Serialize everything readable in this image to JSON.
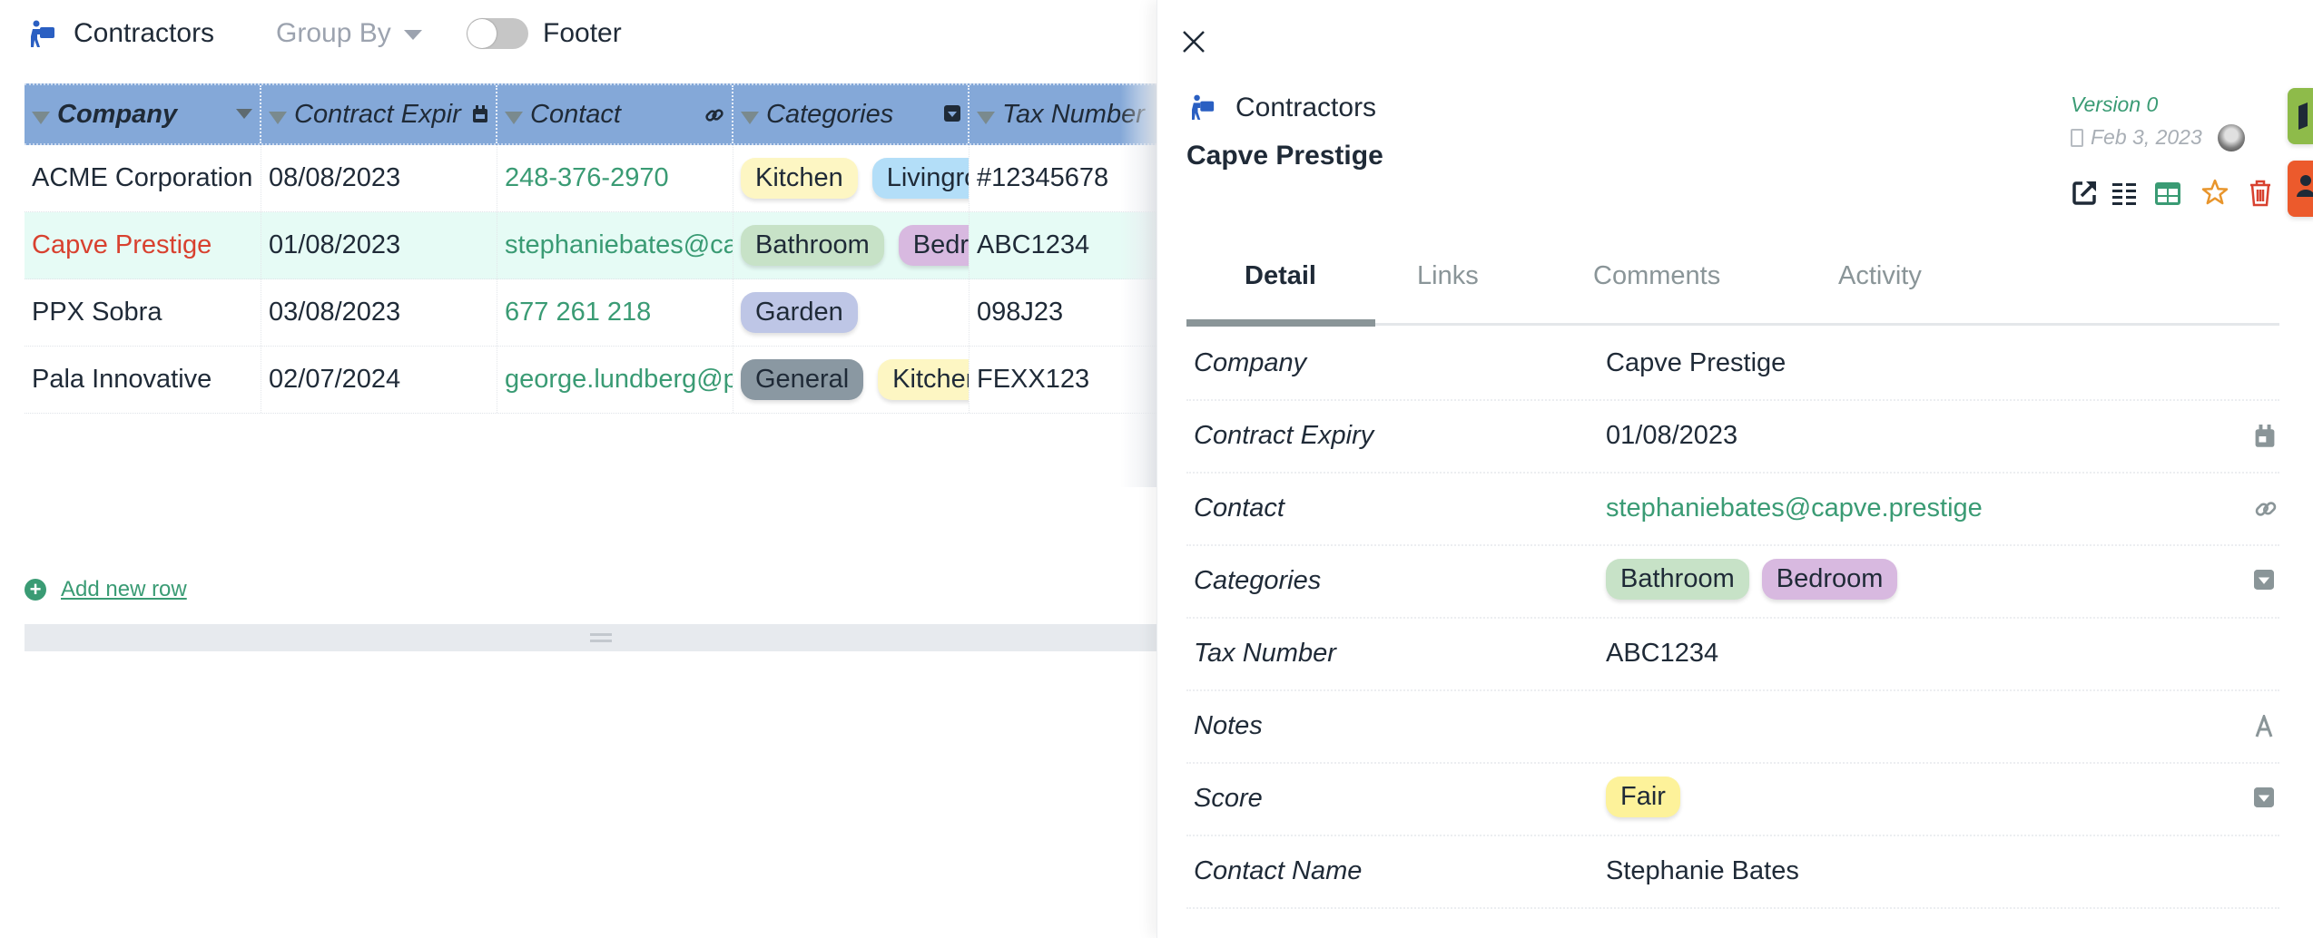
{
  "topbar": {
    "title": "Contractors",
    "title_icon": "person-carrying-box-icon",
    "group_by_label": "Group By",
    "footer_toggle": {
      "label": "Footer",
      "on": false
    }
  },
  "grid": {
    "columns": [
      {
        "label": "Company",
        "type_icon": "caret-down-icon"
      },
      {
        "label": "Contract Expir",
        "type_icon": "calendar-icon"
      },
      {
        "label": "Contact",
        "type_icon": "link-icon"
      },
      {
        "label": "Categories",
        "type_icon": "dropdown-icon"
      },
      {
        "label": "Tax Number",
        "type_icon": ""
      }
    ],
    "rows": [
      {
        "company": "ACME Corporation",
        "expiry": "08/08/2023",
        "contact": "248-376-2970",
        "categories": [
          {
            "label": "Kitchen",
            "color": "#fdf6c3"
          },
          {
            "label": "Livingroom",
            "color": "#b3def8"
          }
        ],
        "tax": "#12345678",
        "selected": false
      },
      {
        "company": "Capve Prestige",
        "expiry": "01/08/2023",
        "contact": "stephaniebates@capve.prestige",
        "categories": [
          {
            "label": "Bathroom",
            "color": "#c7e2c7"
          },
          {
            "label": "Bedroom",
            "color": "#d8b9e0"
          }
        ],
        "tax": "ABC1234",
        "selected": true
      },
      {
        "company": "PPX Sobra",
        "expiry": "03/08/2023",
        "contact": "677 261 218",
        "categories": [
          {
            "label": "Garden",
            "color": "#bec6e6"
          }
        ],
        "tax": "098J23",
        "selected": false
      },
      {
        "company": "Pala Innovative",
        "expiry": "02/07/2024",
        "contact": "george.lundberg@pala.innovative",
        "categories": [
          {
            "label": "General",
            "color": "#8a98a2"
          },
          {
            "label": "Kitchen",
            "color": "#fdf6c3"
          }
        ],
        "tax": "FEXX123",
        "selected": false
      }
    ],
    "add_row_label": "Add new row"
  },
  "panel": {
    "table_name": "Contractors",
    "record_title": "Capve Prestige",
    "version": "Version 0",
    "date": "Feb 3, 2023",
    "actions": [
      "open-external-icon",
      "list-view-icon",
      "table-view-icon",
      "star-icon",
      "trash-icon"
    ],
    "side_tabs": [
      "book-icon",
      "users-icon"
    ],
    "tabs": [
      {
        "label": "Detail",
        "active": true
      },
      {
        "label": "Links",
        "active": false
      },
      {
        "label": "Comments",
        "active": false
      },
      {
        "label": "Activity",
        "active": false
      }
    ],
    "fields": [
      {
        "label": "Company",
        "value": "Capve Prestige",
        "icon": ""
      },
      {
        "label": "Contract Expiry",
        "value": "01/08/2023",
        "icon": "calendar-icon"
      },
      {
        "label": "Contact",
        "value": "stephaniebates@capve.prestige",
        "icon": "link-icon"
      },
      {
        "label": "Categories",
        "chips": [
          {
            "label": "Bathroom",
            "color": "#c7e2c7"
          },
          {
            "label": "Bedroom",
            "color": "#d8b9e0"
          }
        ],
        "icon": "dropdown-icon"
      },
      {
        "label": "Tax Number",
        "value": "ABC1234",
        "icon": ""
      },
      {
        "label": "Notes",
        "value": "",
        "icon": "text-icon"
      },
      {
        "label": "Score",
        "chips": [
          {
            "label": "Fair",
            "color": "#fdf29a"
          }
        ],
        "icon": "dropdown-icon"
      },
      {
        "label": "Contact Name",
        "value": "Stephanie Bates",
        "icon": ""
      }
    ]
  },
  "colors": {
    "accent_green": "#3a9b74",
    "header_blue": "#84a8d8",
    "selected_row": "#e6fbf5",
    "selected_company_red": "#d8412f",
    "star_orange": "#e8952c",
    "trash_red": "#d8412f"
  }
}
